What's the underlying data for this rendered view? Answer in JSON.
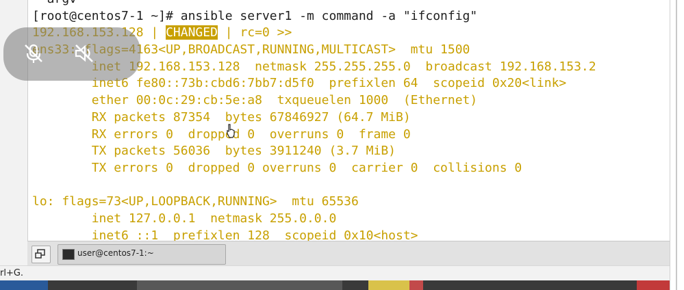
{
  "terminal": {
    "lines": [
      {
        "text": "~ argv",
        "color": "dark"
      },
      {
        "text": "[root@centos7-1 ~]# ansible server1 -m command -a \"ifconfig\"",
        "color": "dark"
      },
      {
        "prefix": "192.168.153.128 | ",
        "badge": "CHANGED",
        "suffix": " | rc=0 >>"
      },
      {
        "text": "ens33: flags=4163<UP,BROADCAST,RUNNING,MULTICAST>  mtu 1500"
      },
      {
        "text": "        inet 192.168.153.128  netmask 255.255.255.0  broadcast 192.168.153.2"
      },
      {
        "text": "        inet6 fe80::73b:cbd6:7bb7:d5f0  prefixlen 64  scopeid 0x20<link>"
      },
      {
        "text": "        ether 00:0c:29:cb:5e:a8  txqueuelen 1000  (Ethernet)"
      },
      {
        "text": "        RX packets 87354  bytes 67846927 (64.7 MiB)"
      },
      {
        "text": "        RX errors 0  dropped 0  overruns 0  frame 0"
      },
      {
        "text": "        TX packets 56036  bytes 3911240 (3.7 MiB)"
      },
      {
        "text": "        TX errors 0  dropped 0 overruns 0  carrier 0  collisions 0"
      },
      {
        "text": ""
      },
      {
        "text": "lo: flags=73<UP,LOOPBACK,RUNNING>  mtu 65536"
      },
      {
        "text": "        inet 127.0.0.1  netmask 255.0.0.0"
      },
      {
        "text": "        inet6 ::1  prefixlen 128  scopeid 0x10<host>"
      }
    ],
    "colors": {
      "output": "#c8a000",
      "prompt": "#1e1e1e",
      "badge_bg": "#c8a000",
      "badge_fg": "#ffffff"
    }
  },
  "overlay": {
    "icons": [
      "mic-muted-icon",
      "speaker-muted-icon"
    ]
  },
  "taskbar": {
    "task_label": "user@centos7-1:~"
  },
  "statusbar": {
    "text": "rl+G."
  }
}
